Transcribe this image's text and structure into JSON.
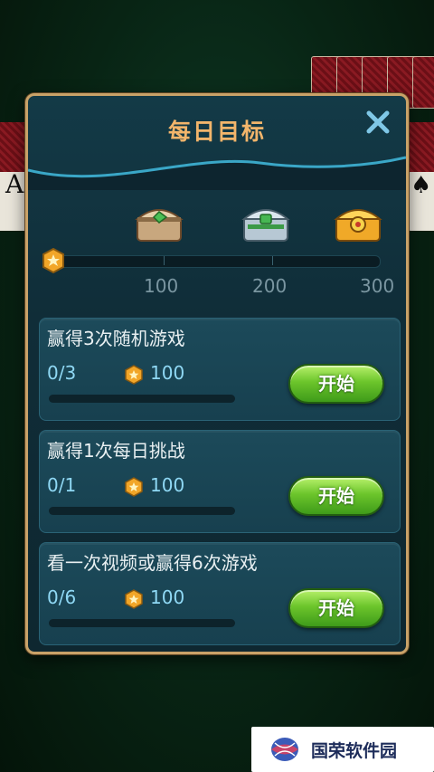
{
  "background": {
    "left_card_glyph": "A",
    "right_card_glyph": "♠"
  },
  "dialog": {
    "title": "每日目标",
    "close_icon": "close-icon"
  },
  "milestones": {
    "labels": [
      "100",
      "200",
      "300"
    ],
    "current_points": 0,
    "max_points": 300,
    "chests": [
      "bronze-chest",
      "silver-chest",
      "gold-chest"
    ]
  },
  "tasks": [
    {
      "title": "赢得3次随机游戏",
      "progress": "0/3",
      "reward": "100",
      "button": "开始",
      "completion": 0
    },
    {
      "title": "赢得1次每日挑战",
      "progress": "0/1",
      "reward": "100",
      "button": "开始",
      "completion": 0
    },
    {
      "title": "看一次视频或赢得6次游戏",
      "progress": "0/6",
      "reward": "100",
      "button": "开始",
      "completion": 0
    }
  ],
  "watermark": {
    "text": "国荣软件园"
  },
  "colors": {
    "title": "#f2b56b",
    "frame": "#c9a268",
    "button_green": "#6cc52b",
    "text_cyan": "#8fd8f4"
  }
}
